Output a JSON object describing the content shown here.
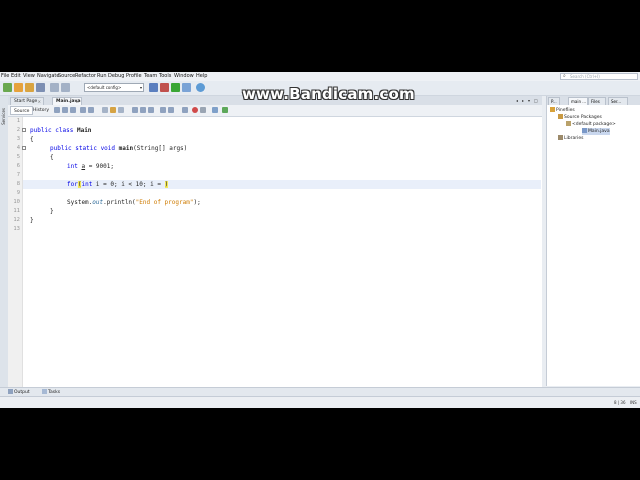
{
  "watermark": "www.Bandicam.com",
  "menu": [
    "File",
    "Edit",
    "View",
    "Navigate",
    "Source",
    "Refactor",
    "Run",
    "Debug",
    "Profile",
    "Team",
    "Tools",
    "Window",
    "Help"
  ],
  "search": {
    "placeholder": "Search (Ctrl+I)"
  },
  "toolbar": {
    "config": "<default config>"
  },
  "editor_tabs": [
    {
      "label": "Start Page"
    },
    {
      "label": "Main.java"
    }
  ],
  "editor_subtabs": {
    "source": "Source",
    "history": "History"
  },
  "left_strip": "Services",
  "code": {
    "line_numbers": [
      "1",
      "2",
      "3",
      "4",
      "5",
      "6",
      "7",
      "8",
      "9",
      "10",
      "11",
      "12",
      "13"
    ],
    "lines": {
      "l2_kw": "public class ",
      "l2_name": "Main",
      "l3": "{",
      "l4_kw": "public static void ",
      "l4_name": "main",
      "l4_rest": "(String[] args)",
      "l5": "{",
      "l6_kw": "int ",
      "l6_var": "a",
      "l6_rest": " = 9001;",
      "l8_kw": "for",
      "l8_p1": "(",
      "l8_kw2": "int ",
      "l8_rest": "i = 0; i < 10; i = ",
      "l8_end": ")",
      "l10_pre": "System.",
      "l10_out": "out",
      "l10_mid": ".println(",
      "l10_str": "\"End of program\"",
      "l10_end": ");",
      "l11": "}",
      "l12": "}"
    }
  },
  "right_panel": {
    "tabs": [
      "P...",
      "main ...",
      "Files",
      "Ser..."
    ],
    "tree": [
      "Pineflies",
      "Source Packages",
      "<default package>",
      "Main.java",
      "Libraries"
    ]
  },
  "status": {
    "output": "Output",
    "tasks": "Tasks"
  },
  "bottombar": {
    "position": "8 | 36",
    "mode": "INS"
  }
}
